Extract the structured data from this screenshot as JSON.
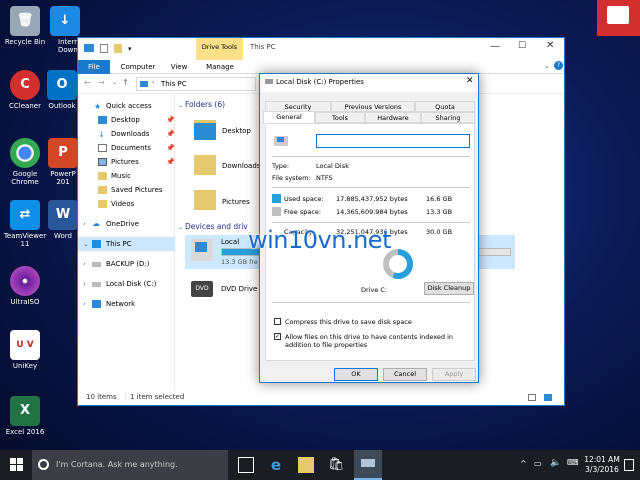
{
  "desktop": {
    "icons": [
      {
        "label": "Recycle Bin",
        "color": "#9aa7b4"
      },
      {
        "label": "Intern\nDown",
        "color": "#1e88e5"
      },
      {
        "label": "CCleaner",
        "color": "#d32f2f"
      },
      {
        "label": "Outlook",
        "color": "#0072c6"
      },
      {
        "label": "Google\nChrome",
        "color": "#34a853"
      },
      {
        "label": "PowerP\n201",
        "color": "#d24726"
      },
      {
        "label": "TeamViewer\n11",
        "color": "#0e8ee9"
      },
      {
        "label": "Word",
        "color": "#2b579a"
      },
      {
        "label": "UltraISO",
        "color": "#6a1b9a"
      },
      {
        "label": "UniKey",
        "color": "#c62828"
      },
      {
        "label": "Excel 2016",
        "color": "#217346"
      }
    ]
  },
  "explorer": {
    "ribbon": {
      "context_group": "Drive Tools",
      "title": "This PC",
      "tabs": [
        "File",
        "Computer",
        "View",
        "Manage"
      ]
    },
    "address": "This PC",
    "nav": [
      {
        "label": "Quick access"
      },
      {
        "label": "Desktop"
      },
      {
        "label": "Downloads"
      },
      {
        "label": "Documents"
      },
      {
        "label": "Pictures"
      },
      {
        "label": "Music"
      },
      {
        "label": "Saved Pictures"
      },
      {
        "label": "Videos"
      },
      {
        "label": "OneDrive"
      },
      {
        "label": "This PC"
      },
      {
        "label": "BACKUP (D:)"
      },
      {
        "label": "Local Disk (C:)"
      },
      {
        "label": "Network"
      }
    ],
    "folders_header": "Folders (6)",
    "folders": [
      "Desktop",
      "Downloads",
      "Pictures"
    ],
    "devices_header": "Devices and driv",
    "devices": [
      {
        "name": "Local",
        "detail": "13.3 GB fre"
      },
      {
        "name": "DVD Drive"
      }
    ],
    "status": {
      "items": "10 items",
      "selected": "1 item selected"
    }
  },
  "dialog": {
    "title": "Local Disk (C:) Properties",
    "tabs_row1": [
      "Security",
      "Previous Versions",
      "Quota"
    ],
    "tabs_row2": [
      "General",
      "Tools",
      "Hardware",
      "Sharing"
    ],
    "name_value": "",
    "type_label": "Type:",
    "type_value": "Local Disk",
    "fs_label": "File system:",
    "fs_value": "NTFS",
    "used_label": "Used space:",
    "used_bytes": "17,885,437,952 bytes",
    "used_gb": "16.6 GB",
    "free_label": "Free space:",
    "free_bytes": "14,365,609,984 bytes",
    "free_gb": "13.3 GB",
    "cap_label": "Capacity:",
    "cap_bytes": "32,251,047,936 bytes",
    "cap_gb": "30.0 GB",
    "used_fraction": 0.555,
    "drive_label": "Drive C:",
    "cleanup": "Disk Cleanup",
    "compress": "Compress this drive to save disk space",
    "index": "Allow files on this drive to have contents indexed in addition to file properties",
    "ok": "OK",
    "cancel": "Cancel",
    "apply": "Apply",
    "used_color": "#26a0da",
    "free_color": "#bfbfbf"
  },
  "watermark": "win10vn.net",
  "taskbar": {
    "search_placeholder": "I'm Cortana. Ask me anything.",
    "time": "12:01 AM",
    "date": "3/3/2016"
  }
}
